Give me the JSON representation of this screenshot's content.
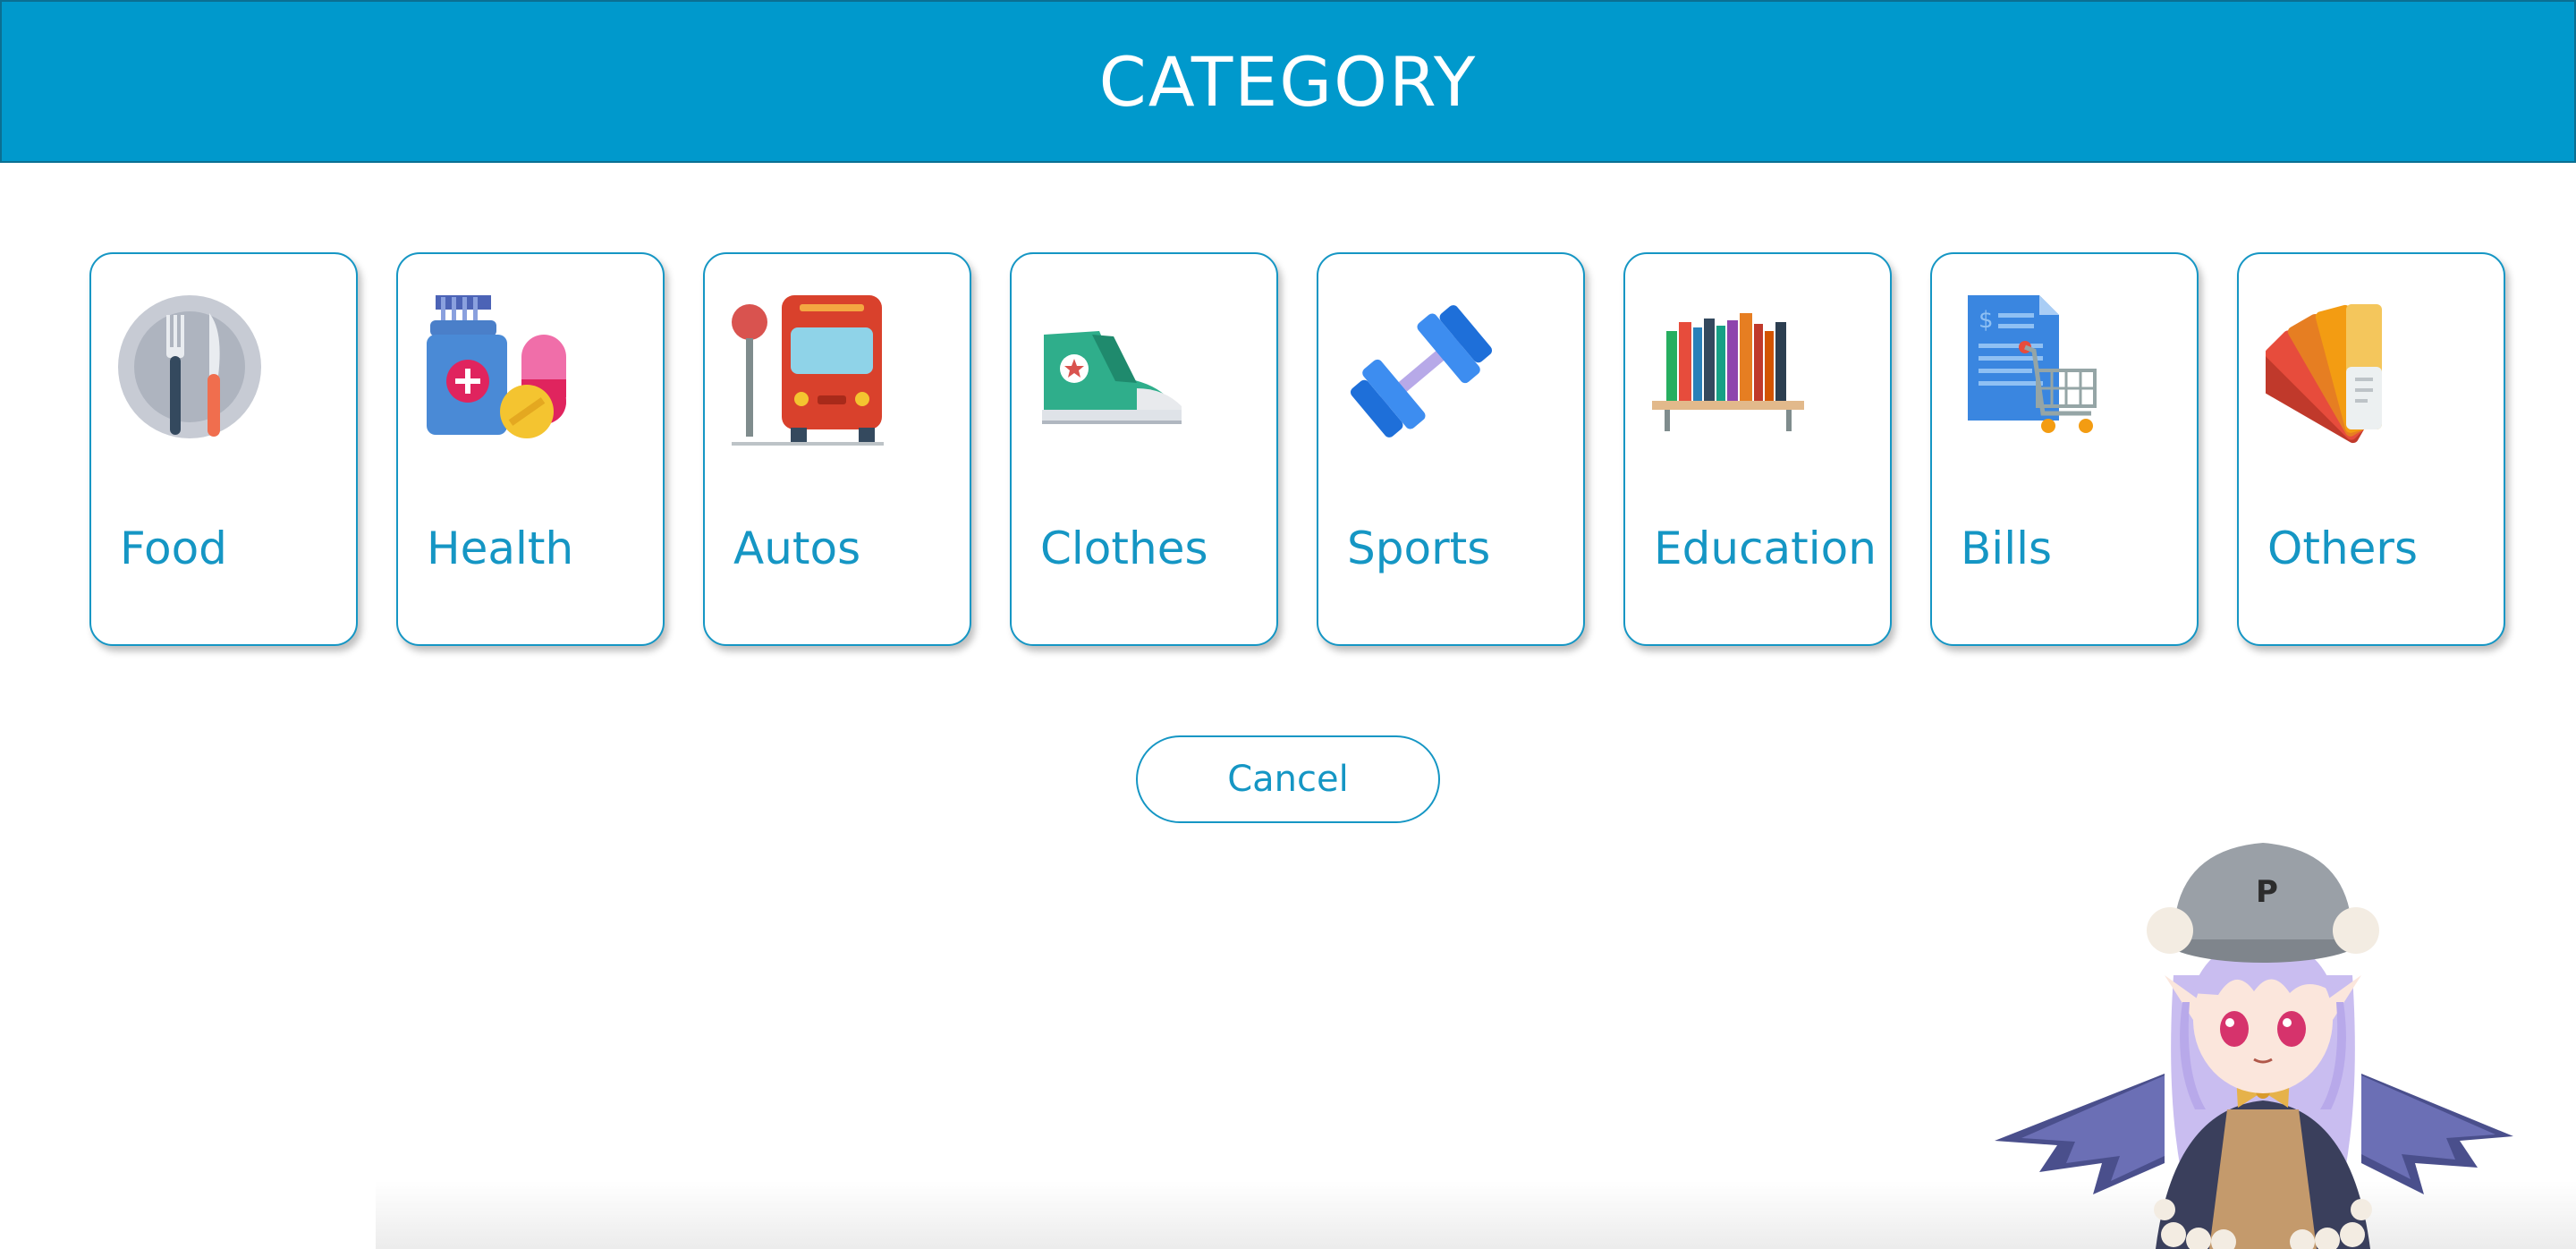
{
  "header": {
    "title": "CATEGORY"
  },
  "categories": [
    {
      "label": "Food",
      "icon": "food-plate-fork-knife-icon"
    },
    {
      "label": "Health",
      "icon": "medicine-pills-icon"
    },
    {
      "label": "Autos",
      "icon": "bus-stop-icon"
    },
    {
      "label": "Clothes",
      "icon": "sneaker-icon"
    },
    {
      "label": "Sports",
      "icon": "dumbbell-icon"
    },
    {
      "label": "Education",
      "icon": "bookshelf-icon"
    },
    {
      "label": "Bills",
      "icon": "invoice-cart-icon"
    },
    {
      "label": "Others",
      "icon": "color-swatches-icon"
    }
  ],
  "actions": {
    "cancel_label": "Cancel"
  },
  "mascot": {
    "cap_letter": "P"
  },
  "colors": {
    "accent": "#0099cc",
    "text_accent": "#1596c4",
    "background": "#ffffff"
  }
}
